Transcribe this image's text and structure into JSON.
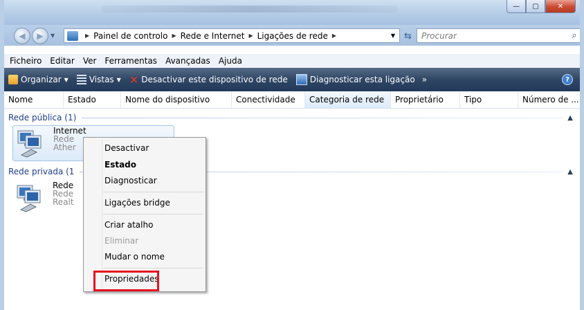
{
  "address": {
    "breadcrumbs": [
      "Painel de controlo",
      "Rede e Internet",
      "Ligações de rede"
    ],
    "search_placeholder": "Procurar"
  },
  "menu": [
    "Ficheiro",
    "Editar",
    "Ver",
    "Ferramentas",
    "Avançadas",
    "Ajuda"
  ],
  "toolbar": {
    "organize": "Organizar",
    "views": "Vistas",
    "disable": "Desactivar este dispositivo de rede",
    "diagnose": "Diagnosticar esta ligação",
    "more": "»"
  },
  "columns": [
    "Nome",
    "Estado",
    "Nome do dispositivo",
    "Conectividade",
    "Categoria de rede",
    "Proprietário",
    "Tipo",
    "Número de ..."
  ],
  "groups": [
    {
      "label": "Rede pública (1)",
      "item": {
        "name": "Internet",
        "line2": "Rede",
        "line3": "Ather"
      }
    },
    {
      "label": "Rede privada (1",
      "item": {
        "name": "Rede",
        "line2": "Rede",
        "line3": "Realt"
      }
    }
  ],
  "context_menu": {
    "disable": "Desactivar",
    "status": "Estado",
    "diagnose": "Diagnosticar",
    "bridge": "Ligações bridge",
    "shortcut": "Criar atalho",
    "delete": "Eliminar",
    "rename": "Mudar o nome",
    "properties": "Propriedades"
  },
  "colors": {
    "highlight": "#e8101e",
    "group_label": "#1e3f8a",
    "toolbar": "#2f4664"
  }
}
